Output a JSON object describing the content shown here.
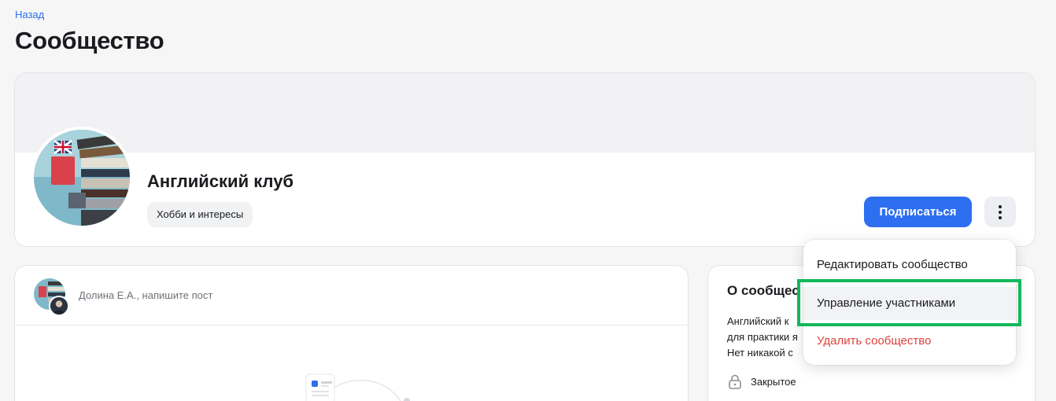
{
  "nav": {
    "back_label": "Назад"
  },
  "page": {
    "title": "Сообщество"
  },
  "community": {
    "name": "Английский клуб",
    "category": "Хобби и интересы",
    "subscribe_label": "Подписаться"
  },
  "feed": {
    "composer_placeholder": "Долина Е.А., напишите пост"
  },
  "about": {
    "title": "О сообщес",
    "description_lines": [
      "Английский к",
      "для практики я",
      "Нет никакой с"
    ],
    "privacy": "Закрытое"
  },
  "menu": {
    "items": [
      {
        "label": "Редактировать сообщество"
      },
      {
        "label": "Управление участниками"
      },
      {
        "label": "Удалить сообщество"
      }
    ]
  },
  "colors": {
    "accent": "#2d6ff0",
    "danger": "#e0413d",
    "highlight": "#12b85c",
    "background": "#f6f6f7"
  },
  "icons": {
    "more": "more-vertical-icon",
    "privacy": "lock-icon"
  }
}
